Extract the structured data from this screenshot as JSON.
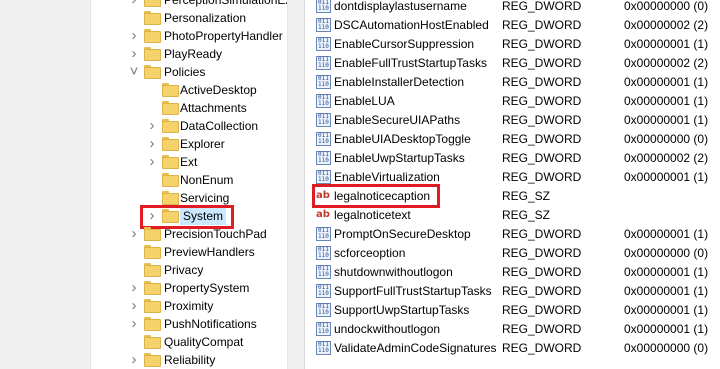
{
  "tree": {
    "items": [
      {
        "label": "PerceptionSimulationExtensions",
        "level": 1,
        "chevron": ">"
      },
      {
        "label": "Personalization",
        "level": 1,
        "chevron": ""
      },
      {
        "label": "PhotoPropertyHandler",
        "level": 1,
        "chevron": ">"
      },
      {
        "label": "PlayReady",
        "level": 1,
        "chevron": ">"
      },
      {
        "label": "Policies",
        "level": 1,
        "chevron": "v"
      },
      {
        "label": "ActiveDesktop",
        "level": 2,
        "chevron": ""
      },
      {
        "label": "Attachments",
        "level": 2,
        "chevron": ""
      },
      {
        "label": "DataCollection",
        "level": 2,
        "chevron": ">"
      },
      {
        "label": "Explorer",
        "level": 2,
        "chevron": ">"
      },
      {
        "label": "Ext",
        "level": 2,
        "chevron": ">"
      },
      {
        "label": "NonEnum",
        "level": 2,
        "chevron": ""
      },
      {
        "label": "Servicing",
        "level": 2,
        "chevron": ""
      },
      {
        "label": "System",
        "level": 2,
        "chevron": ">",
        "selected": true
      },
      {
        "label": "PrecisionTouchPad",
        "level": 1,
        "chevron": ">"
      },
      {
        "label": "PreviewHandlers",
        "level": 1,
        "chevron": ""
      },
      {
        "label": "Privacy",
        "level": 1,
        "chevron": ""
      },
      {
        "label": "PropertySystem",
        "level": 1,
        "chevron": ">"
      },
      {
        "label": "Proximity",
        "level": 1,
        "chevron": ">"
      },
      {
        "label": "PushNotifications",
        "level": 1,
        "chevron": ">"
      },
      {
        "label": "QualityCompat",
        "level": 1,
        "chevron": ""
      },
      {
        "label": "Reliability",
        "level": 1,
        "chevron": ">"
      }
    ]
  },
  "values": [
    {
      "name": "dontdisplaylastusername",
      "type": "REG_DWORD",
      "data": "0x00000000 (0)",
      "kind": "dword"
    },
    {
      "name": "DSCAutomationHostEnabled",
      "type": "REG_DWORD",
      "data": "0x00000002 (2)",
      "kind": "dword"
    },
    {
      "name": "EnableCursorSuppression",
      "type": "REG_DWORD",
      "data": "0x00000001 (1)",
      "kind": "dword"
    },
    {
      "name": "EnableFullTrustStartupTasks",
      "type": "REG_DWORD",
      "data": "0x00000002 (2)",
      "kind": "dword"
    },
    {
      "name": "EnableInstallerDetection",
      "type": "REG_DWORD",
      "data": "0x00000001 (1)",
      "kind": "dword"
    },
    {
      "name": "EnableLUA",
      "type": "REG_DWORD",
      "data": "0x00000001 (1)",
      "kind": "dword"
    },
    {
      "name": "EnableSecureUIAPaths",
      "type": "REG_DWORD",
      "data": "0x00000001 (1)",
      "kind": "dword"
    },
    {
      "name": "EnableUIADesktopToggle",
      "type": "REG_DWORD",
      "data": "0x00000000 (0)",
      "kind": "dword"
    },
    {
      "name": "EnableUwpStartupTasks",
      "type": "REG_DWORD",
      "data": "0x00000002 (2)",
      "kind": "dword"
    },
    {
      "name": "EnableVirtualization",
      "type": "REG_DWORD",
      "data": "0x00000001 (1)",
      "kind": "dword"
    },
    {
      "name": "legalnoticecaption",
      "type": "REG_SZ",
      "data": "",
      "kind": "sz",
      "highlighted": true
    },
    {
      "name": "legalnoticetext",
      "type": "REG_SZ",
      "data": "",
      "kind": "sz"
    },
    {
      "name": "PromptOnSecureDesktop",
      "type": "REG_DWORD",
      "data": "0x00000001 (1)",
      "kind": "dword"
    },
    {
      "name": "scforceoption",
      "type": "REG_DWORD",
      "data": "0x00000000 (0)",
      "kind": "dword"
    },
    {
      "name": "shutdownwithoutlogon",
      "type": "REG_DWORD",
      "data": "0x00000001 (1)",
      "kind": "dword"
    },
    {
      "name": "SupportFullTrustStartupTasks",
      "type": "REG_DWORD",
      "data": "0x00000001 (1)",
      "kind": "dword"
    },
    {
      "name": "SupportUwpStartupTasks",
      "type": "REG_DWORD",
      "data": "0x00000001 (1)",
      "kind": "dword"
    },
    {
      "name": "undockwithoutlogon",
      "type": "REG_DWORD",
      "data": "0x00000001 (1)",
      "kind": "dword"
    },
    {
      "name": "ValidateAdminCodeSignatures",
      "type": "REG_DWORD",
      "data": "0x00000000 (0)",
      "kind": "dword"
    }
  ],
  "colors": {
    "highlight_box": "#e01b24",
    "selection": "#cce8ff",
    "folder": "#f6d26a"
  }
}
